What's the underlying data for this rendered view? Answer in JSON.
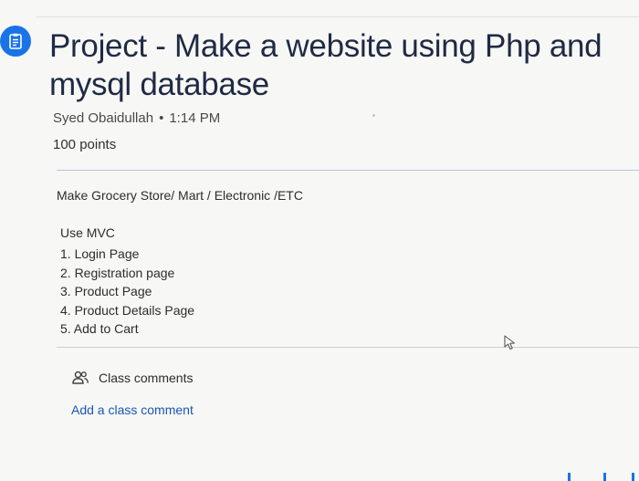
{
  "assignment": {
    "icon": "assignment-icon",
    "title": "Project - Make a website using Php and mysql database",
    "author": "Syed Obaidullah",
    "separator": "•",
    "time": "1:14 PM",
    "points": "100 points"
  },
  "description": {
    "line1": "Make Grocery Store/ Mart / Electronic /ETC",
    "mvc": "Use MVC",
    "items": [
      "1. Login Page",
      "2. Registration page",
      "3. Product Page",
      "4. Product Details Page",
      "5. Add to Cart"
    ]
  },
  "comments": {
    "icon": "people-icon",
    "heading": "Class comments",
    "add_label": "Add a class comment"
  },
  "colors": {
    "accent": "#1a73e8",
    "link": "#1a56b8",
    "title": "#1f2a44"
  }
}
